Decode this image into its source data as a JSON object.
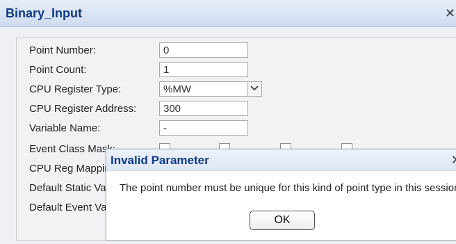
{
  "window": {
    "title": "Binary_Input",
    "close_glyph": "✕"
  },
  "form": {
    "point_number": {
      "label": "Point Number:",
      "value": "0"
    },
    "point_count": {
      "label": "Point Count:",
      "value": "1"
    },
    "cpu_register_type": {
      "label": "CPU Register Type:",
      "value": "%MW"
    },
    "cpu_register_address": {
      "label": "CPU Register Address:",
      "value": "300"
    },
    "variable_name": {
      "label": "Variable Name:",
      "value": "-"
    },
    "event_class_mask": {
      "label": "Event Class Mask:"
    },
    "cpu_reg_mapping": {
      "label": "CPU Reg Mapping:"
    },
    "default_static_variation": {
      "label": "Default Static Variation:"
    },
    "default_event_variation": {
      "label": "Default Event Variation:"
    }
  },
  "dialog": {
    "title": "Invalid Parameter",
    "close_glyph": "✕",
    "message": "The point number must be unique for this kind of point type in this session.",
    "ok_label": "OK"
  },
  "colors": {
    "title_text": "#0e3a86",
    "panel_bg": "#f1f2f4",
    "dialog_bg": "#ffffff"
  }
}
